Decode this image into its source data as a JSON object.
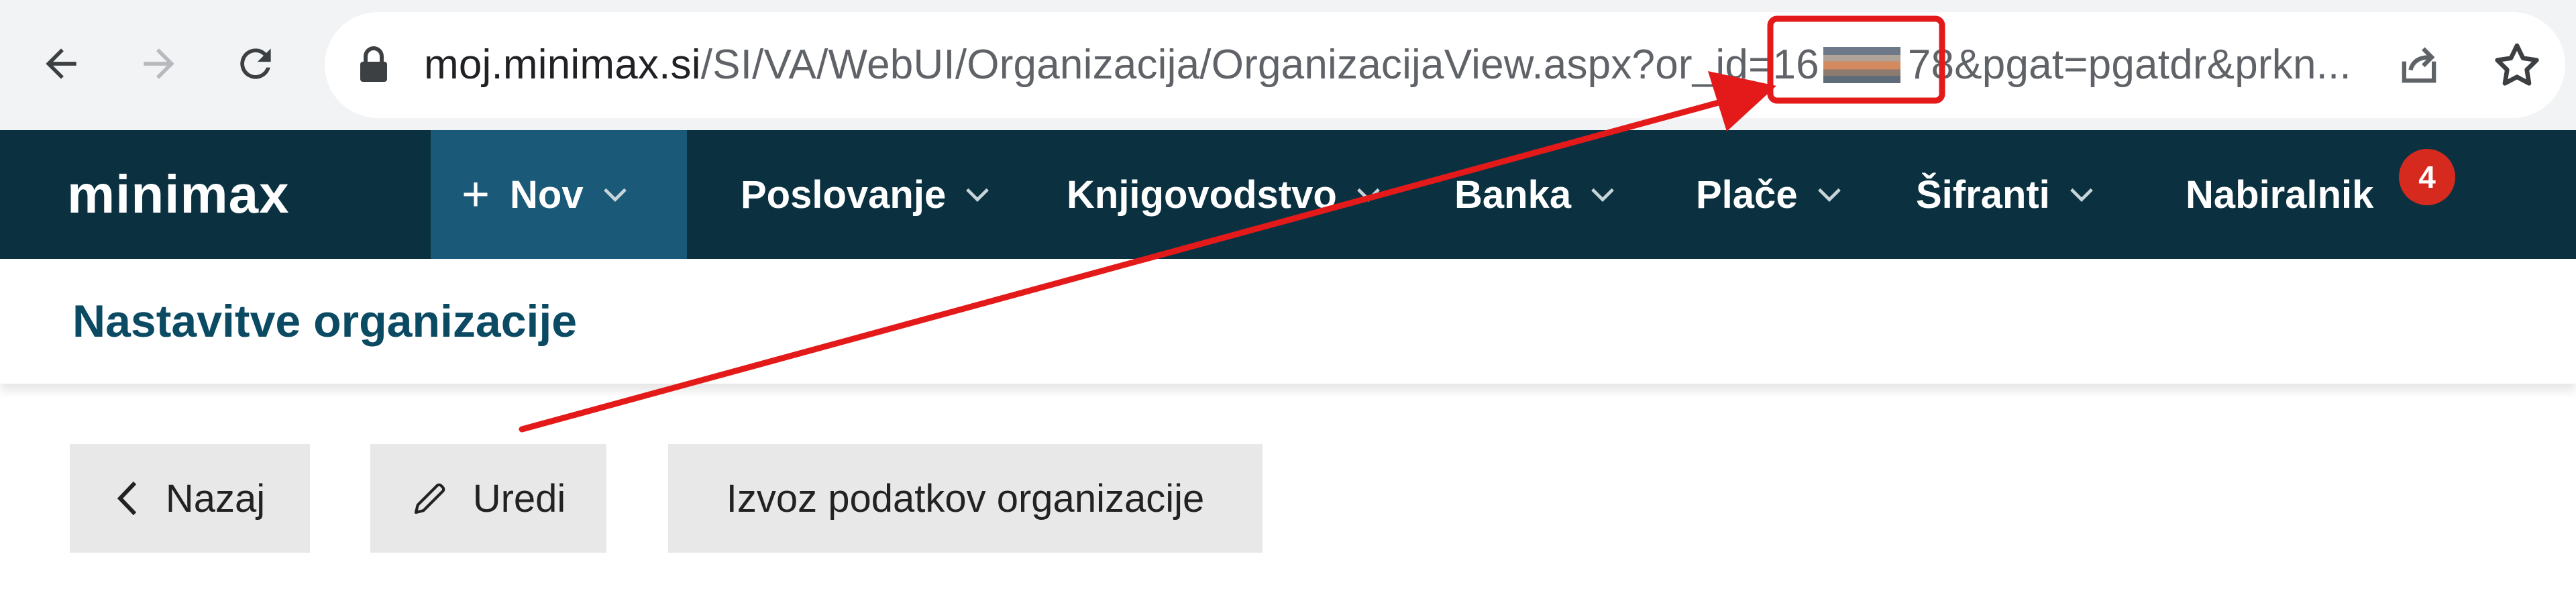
{
  "browser": {
    "url_host": "moj.minimax.si",
    "url_path_before": "/SI/VA/WebUI/Organizacija/OrganizacijaView.aspx?or_id=16",
    "url_path_after": "78&pgat=pgatdr&prkn...",
    "icons": [
      "back-icon",
      "forward-icon",
      "reload-icon",
      "lock-icon",
      "share-icon",
      "star-icon"
    ]
  },
  "appbar": {
    "logo": "minimax",
    "new_label": "Nov",
    "menu": [
      {
        "label": "Poslovanje"
      },
      {
        "label": "Knjigovodstvo"
      },
      {
        "label": "Banka"
      },
      {
        "label": "Plače"
      },
      {
        "label": "Šifranti"
      },
      {
        "label": "Nabiralnik"
      }
    ],
    "inbox_count": "4"
  },
  "page": {
    "title": "Nastavitve organizacije",
    "buttons": {
      "back": "Nazaj",
      "edit": "Uredi",
      "export": "Izvoz podatkov organizacije"
    }
  },
  "colors": {
    "appbar_bg": "#0b3141",
    "nov_bg": "#1a5a78",
    "title": "#0b4a63",
    "badge": "#d72a1e",
    "annotation": "#e41a1a"
  }
}
